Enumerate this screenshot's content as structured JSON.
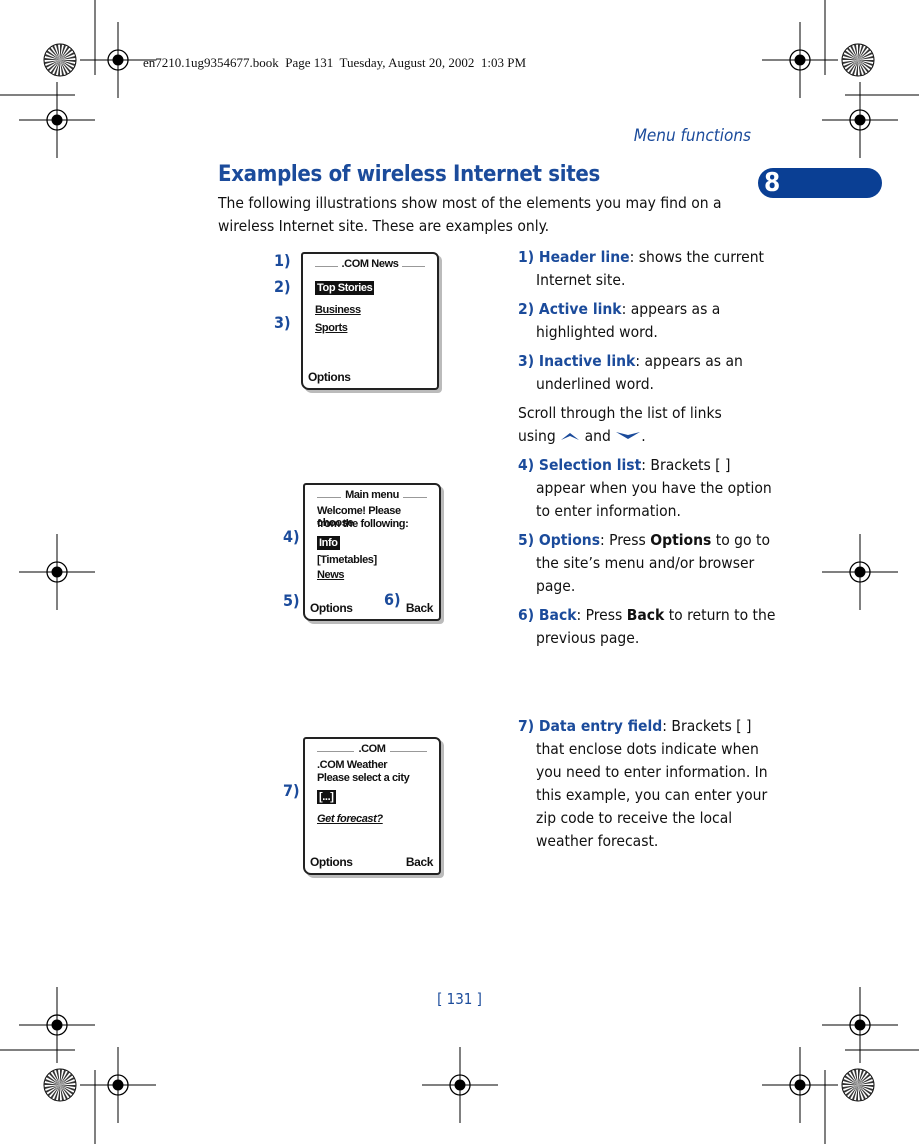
{
  "print_header": "en7210.1ug9354677.book  Page 131  Tuesday, August 20, 2002  1:03 PM",
  "section": "Menu functions",
  "chapter": "8",
  "title": "Examples of wireless Internet sites",
  "intro": "The following illustrations show most of the elements you may find on a wireless Internet site. These are examples only.",
  "screens": [
    {
      "header": ".COM News",
      "lines": [
        "Top Stories",
        "Business",
        "Sports"
      ],
      "left_soft": "Options",
      "labels": [
        "1)",
        "2)",
        "3)"
      ]
    },
    {
      "header": "Main menu",
      "lines": [
        "Welcome! Please choose",
        "from the following:",
        "Info",
        "[Timetables]",
        "News"
      ],
      "left_soft": "Options",
      "right_soft": "Back",
      "labels": [
        "4)",
        "5)",
        "6)"
      ]
    },
    {
      "header": ".COM",
      "lines": [
        ".COM Weather",
        "Please select a city",
        "[...]",
        "Get forecast?"
      ],
      "left_soft": "Options",
      "right_soft": "Back",
      "labels": [
        "7)"
      ]
    }
  ],
  "items": [
    {
      "key": "1) Header line",
      "text": ": shows the current Internet site."
    },
    {
      "key": "2) Active link",
      "text": ": appears as a highlighted word."
    },
    {
      "key": "3) Inactive link",
      "text": ": appears as an underlined word."
    },
    {
      "scroll_a": "Scroll through the list of links using",
      "scroll_and": "and",
      "scroll_end": "."
    },
    {
      "key": "4) Selection list",
      "text": ": Brackets [ ] appear when you have the option to enter information."
    },
    {
      "key": "5) Options",
      "text_a": ": Press ",
      "bold": "Options",
      "text_b": " to go to the site’s menu and/or browser page."
    },
    {
      "key": "6) Back",
      "text_a": ": Press ",
      "bold": "Back",
      "text_b": " to return to the previous page."
    },
    {
      "key": "7) Data entry field",
      "text": ": Brackets [ ] that enclose dots indicate when you need to enter information. In this example, you can enter your zip code to receive the local weather forecast."
    }
  ],
  "icons": {
    "up": "scroll-up-icon",
    "down": "scroll-down-icon"
  },
  "page_number": "[ 131 ]",
  "colors": {
    "accent": "#1b4b9b",
    "chapter_tab": "#0a3f94"
  }
}
